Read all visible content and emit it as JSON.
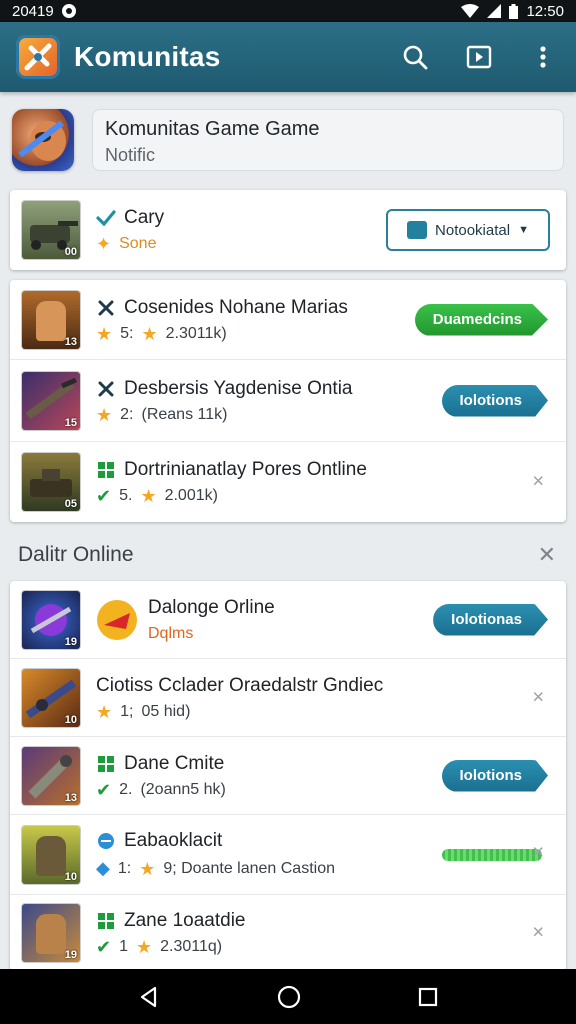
{
  "status_bar": {
    "left_text": "20419",
    "time": "12:50"
  },
  "app_bar": {
    "title": "Komunitas",
    "icons": [
      "search-icon",
      "play-box-icon",
      "more-vert-icon"
    ],
    "color": "#1e5a70"
  },
  "header_card": {
    "title": "Komunitas Game Game",
    "subtitle": "Notific"
  },
  "featured": {
    "title": "Cary",
    "subtitle": "Sone",
    "button_label": "Notookiatal",
    "level": "00"
  },
  "list1": [
    {
      "title": "Cosenides Nohane Marias",
      "rating_prefix": "5:",
      "rating_text": "2.3011k)",
      "level": "13",
      "action": "Duamedcins",
      "action_style": "green"
    },
    {
      "title": "Desbersis Yagdenise Ontia",
      "rating_prefix": "2:",
      "rating_text": "(Reans 11k)",
      "level": "15",
      "action": "Iolotions",
      "action_style": "teal"
    },
    {
      "title": "Dortrinianatlay Pores Ontline",
      "rating_prefix": "5.",
      "rating_text": "2.001k)",
      "level": "05",
      "action": "",
      "action_style": "close"
    }
  ],
  "section": {
    "title": "Dalitr Online"
  },
  "list2": [
    {
      "title": "Dalonge Orline",
      "sub": "Dqlms",
      "level": "19",
      "action": "Iolotionas",
      "action_style": "teal"
    },
    {
      "title": "Ciotiss Cclader Oraedalstr Gndiec",
      "rating_prefix": "1;",
      "rating_text": "05 hid)",
      "level": "10",
      "action": "",
      "action_style": "close"
    },
    {
      "title": "Dane Cmite",
      "rating_prefix": "2.",
      "rating_text": "(2oann5 hk)",
      "level": "13",
      "action": "Iolotions",
      "action_style": "teal"
    },
    {
      "title": "Eabaoklacit",
      "rating_prefix": "1:",
      "rating_text": "9; Doante lanen Castion",
      "level": "10",
      "action": "",
      "action_style": "bar"
    },
    {
      "title": "Zane 1oaatdie",
      "rating_prefix": "1",
      "rating_text": "2.3011q)",
      "level": "19",
      "action": "",
      "action_style": "close"
    }
  ]
}
